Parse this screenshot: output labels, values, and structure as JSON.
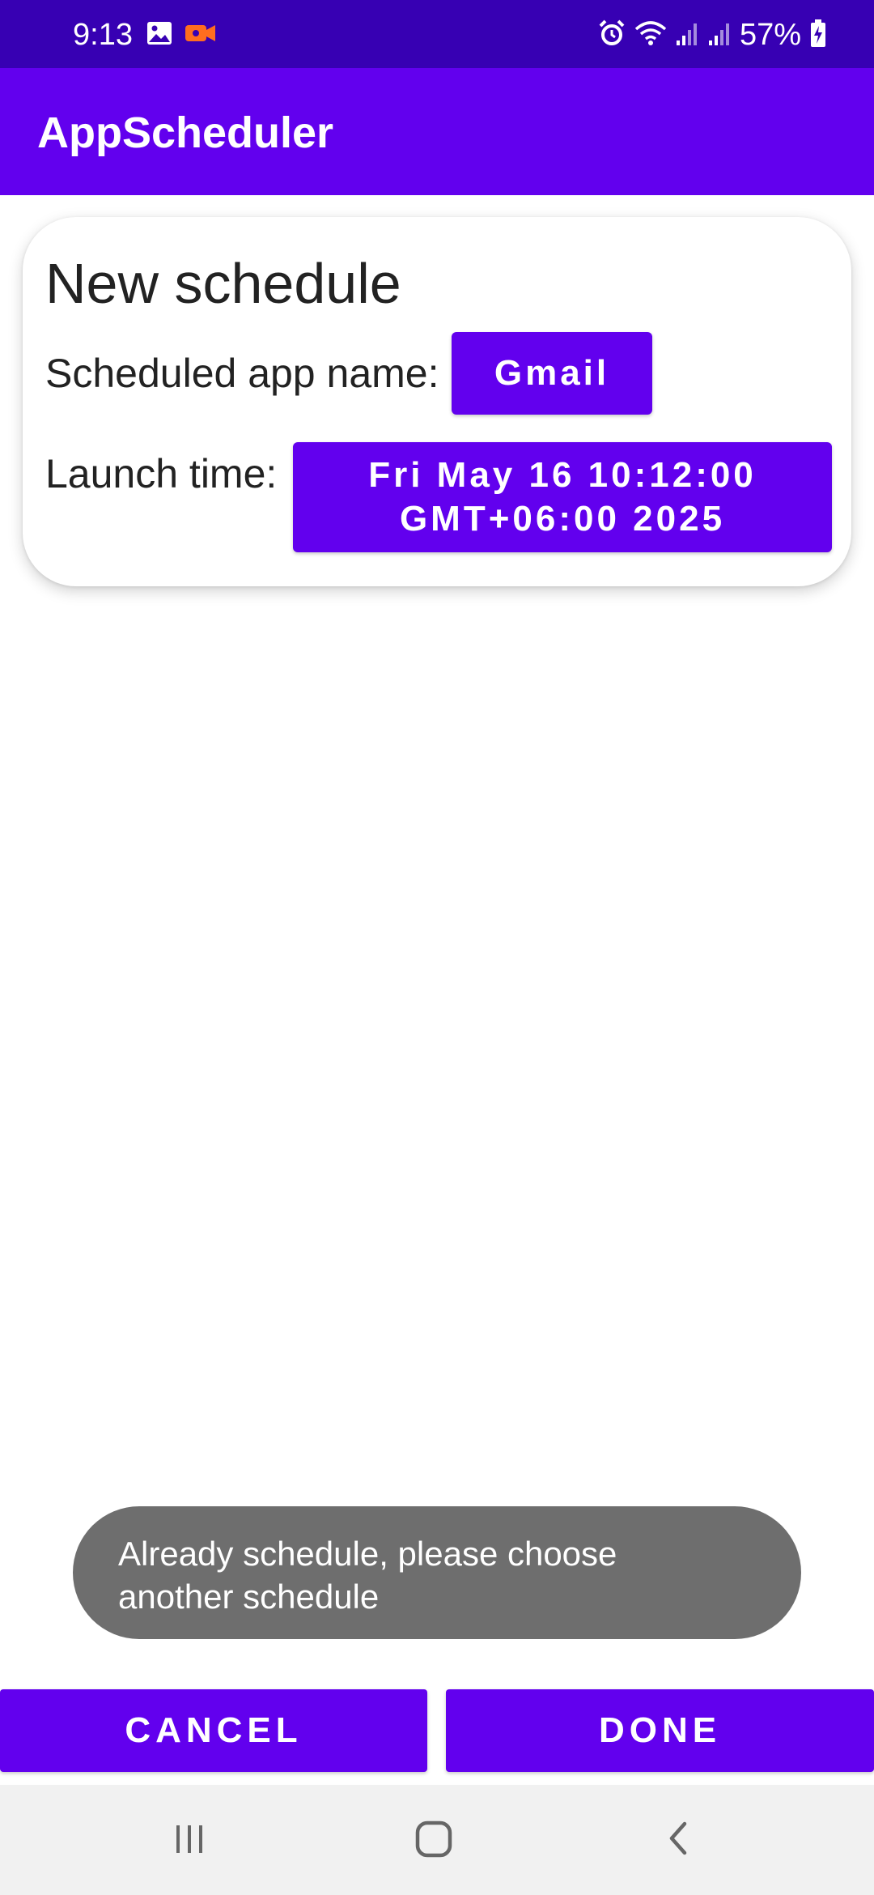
{
  "status_bar": {
    "time": "9:13",
    "battery_percent": "57%",
    "left_icons": [
      "gallery-icon",
      "video-record-icon"
    ],
    "right_icons": [
      "alarm-icon",
      "wifi-icon",
      "signal-icon",
      "signal-icon",
      "battery-charging-icon"
    ],
    "colors": {
      "background": "#3700b3",
      "video_icon": "#ff6d1f"
    }
  },
  "app_bar": {
    "title": "AppScheduler",
    "background": "#6200ee"
  },
  "card": {
    "title": "New schedule",
    "app_label": "Scheduled app name:",
    "app_value": "Gmail",
    "time_label": "Launch time:",
    "time_value_line1": "Fri May 16 10:12:00",
    "time_value_line2": "GMT+06:00 2025"
  },
  "toast": {
    "line1": "Already schedule, please choose",
    "line2": "another schedule"
  },
  "actions": {
    "cancel_label": "CANCEL",
    "done_label": "DONE"
  },
  "nav_bar": {
    "icons": [
      "recents-icon",
      "home-icon",
      "back-icon"
    ]
  },
  "colors": {
    "primary": "#6200ee",
    "primary_dark": "#3700b3",
    "toast_bg": "#6e6e6e"
  }
}
